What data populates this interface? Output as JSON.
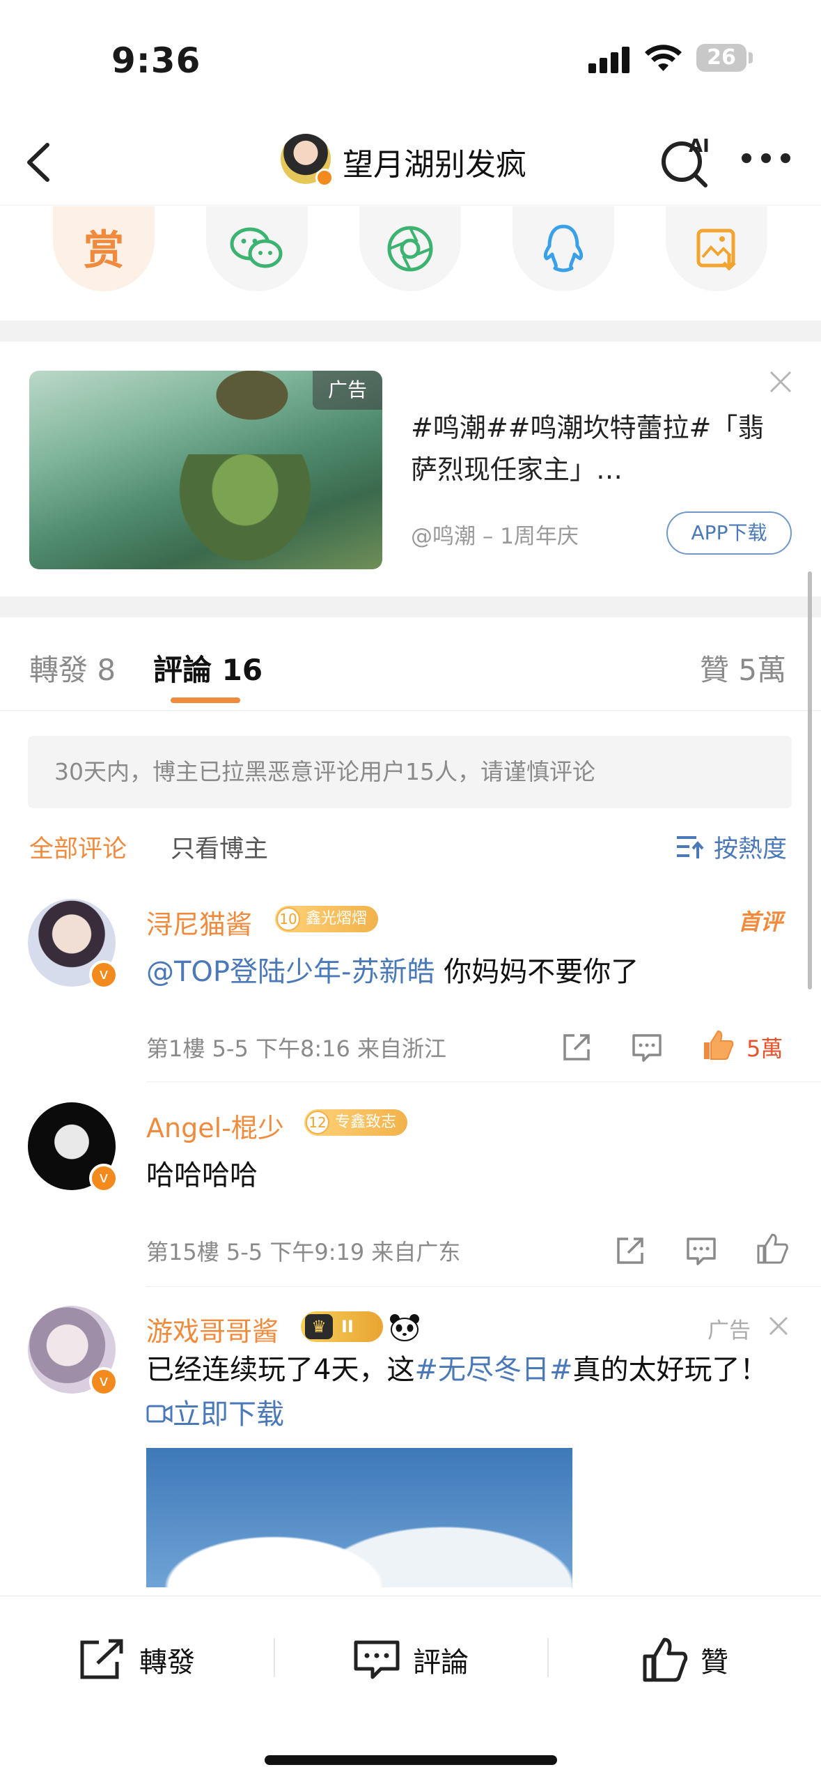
{
  "status_bar": {
    "time": "9:36",
    "battery": "26"
  },
  "header": {
    "title": "望月湖别发疯"
  },
  "share": {
    "reward_label": "赏"
  },
  "ad": {
    "tag": "广告",
    "title": "#鸣潮##鸣潮坎特蕾拉#「翡萨烈现任家主」…",
    "source": "@鸣潮 – 1周年庆",
    "button": "APP下载"
  },
  "tabs": {
    "repost": "轉發 8",
    "comments": "評論 16",
    "likes": "贊 5萬"
  },
  "notice": "30天内，博主已拉黑恶意评论用户15人，请谨慎评论",
  "filters": {
    "all": "全部评论",
    "author_only": "只看博主",
    "sort": "按熱度"
  },
  "comments": [
    {
      "user": "浔尼猫酱",
      "badge_level": "10",
      "badge_text": "鑫光熠熠",
      "tag": "首评",
      "mention": "@TOP登陆少年-苏新皓",
      "text": " 你妈妈不要你了",
      "meta": "第1樓  5-5  下午8:16  来自浙江",
      "likes": "5萬"
    },
    {
      "user": "Angel-棍少",
      "badge_level": "12",
      "badge_text": "专鑫致志",
      "text": "哈哈哈哈",
      "meta": "第15樓  5-5  下午9:19  来自广东"
    },
    {
      "user": "游戏哥哥酱",
      "crown_level": "II",
      "ad_label": "广告",
      "text_before": "已经连续玩了4天，这",
      "hashtag": "#无尽冬日#",
      "text_after": "真的太好玩了！",
      "download": "立即下载"
    }
  ],
  "bottom_bar": {
    "repost": "轉發",
    "comment": "評論",
    "like": "贊"
  },
  "colors": {
    "accent_orange": "#f08a3c",
    "link_blue": "#4b79b8",
    "like_red": "#e8532c"
  }
}
